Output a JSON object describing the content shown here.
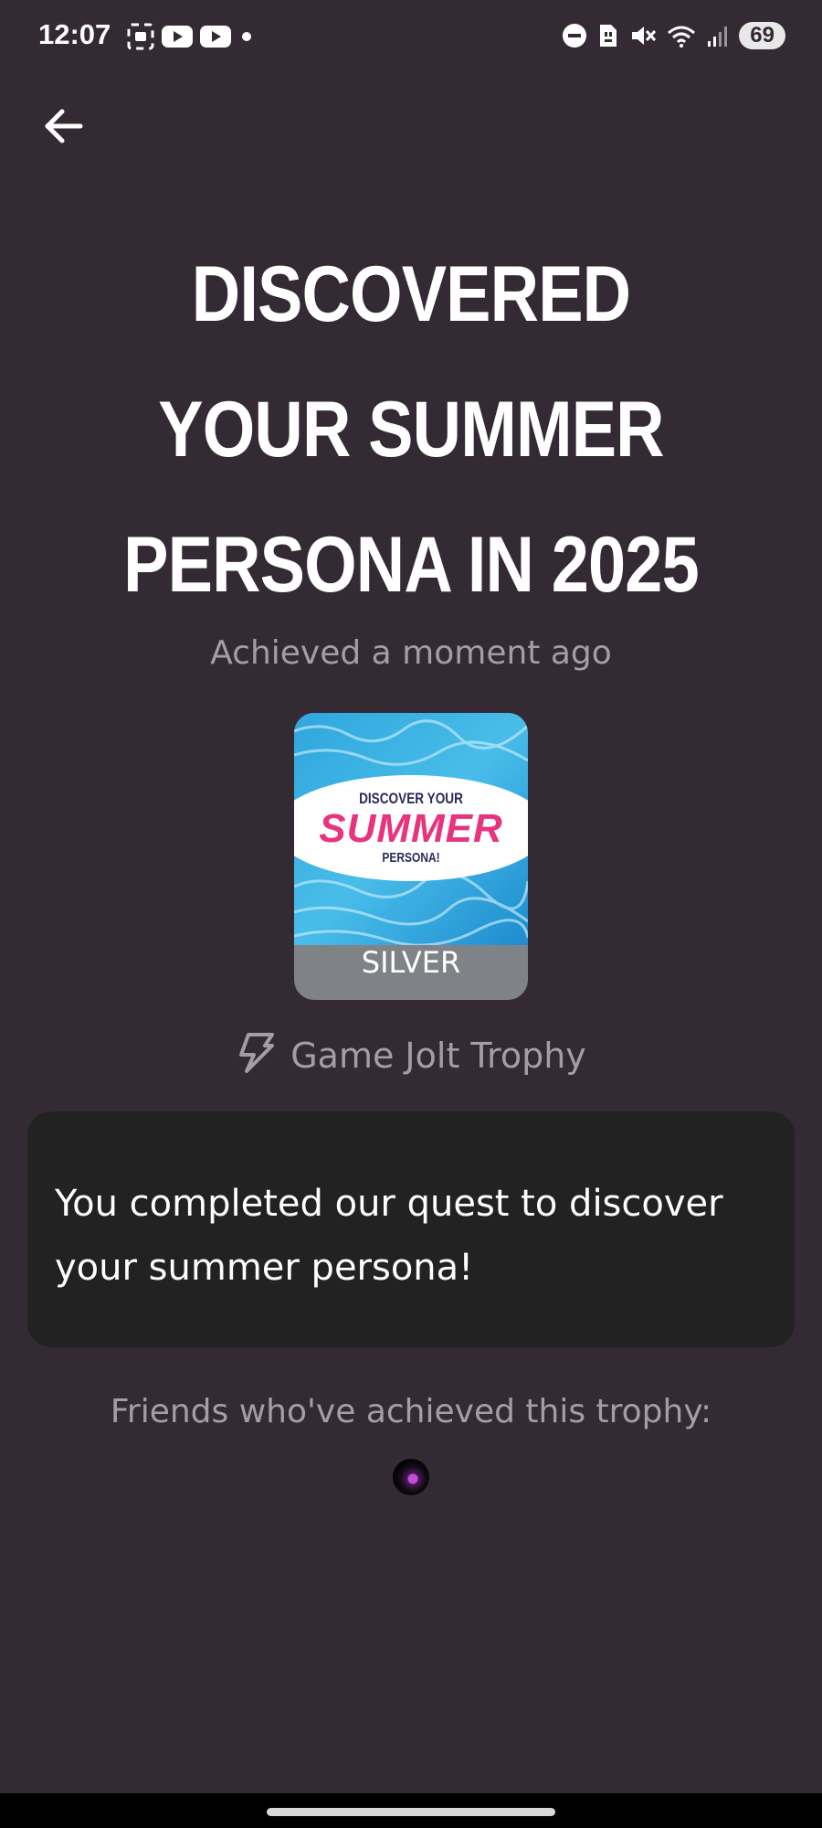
{
  "status_bar": {
    "time": "12:07",
    "battery": "69",
    "left_icons": [
      "screenshot-icon",
      "youtube-icon",
      "youtube-icon",
      "dot-icon"
    ],
    "right_icons": [
      "dnd-icon",
      "sim-icon",
      "mute-icon",
      "wifi-icon",
      "signal-icon"
    ]
  },
  "header": {
    "back_icon": "back-arrow-icon"
  },
  "trophy": {
    "title": "DISCOVERED YOUR SUMMER PERSONA IN 2025",
    "achieved": "Achieved a moment ago",
    "image": {
      "line1": "DISCOVER YOUR",
      "line2": "SUMMER",
      "line3": "PERSONA!"
    },
    "tier": "SILVER",
    "type": "Game Jolt Trophy",
    "description": "You completed our quest to discover your summer persona!"
  },
  "friends": {
    "label": "Friends who've achieved this trophy:"
  },
  "colors": {
    "background": "#342a33",
    "card": "#232223",
    "muted_text": "#a49ea4",
    "tier_silver": "#7f8387",
    "summer_pink": "#e8337e"
  }
}
